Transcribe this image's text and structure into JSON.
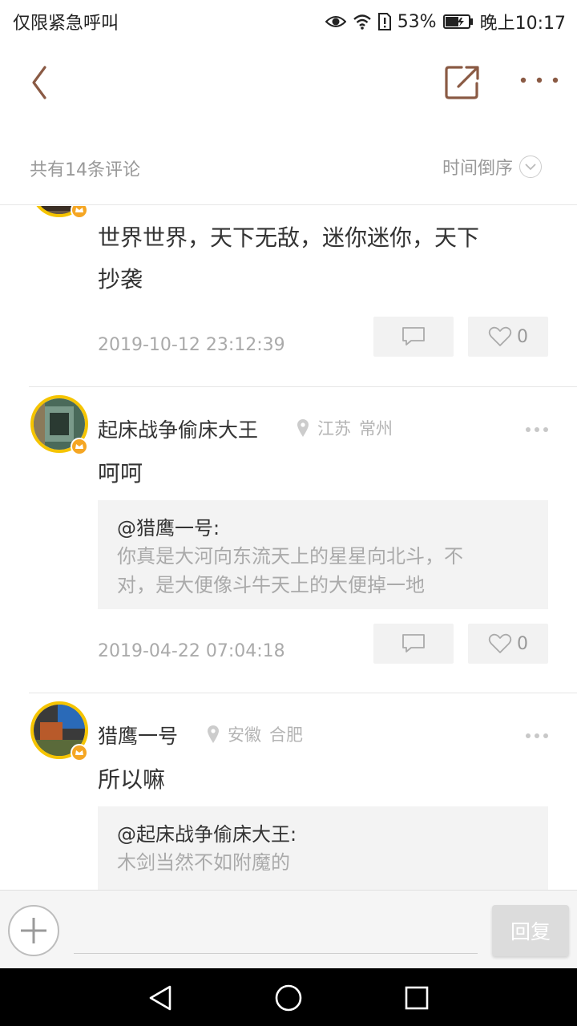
{
  "status_bar": {
    "carrier": "仅限紧急呼叫",
    "battery": "53%",
    "time": "晚上10:17"
  },
  "header": {
    "back_icon": "chevron-left-icon",
    "share_icon": "share-external-icon",
    "more_icon": "more-dots-icon"
  },
  "filter": {
    "count_label": "共有14条评论",
    "sort_label": "时间倒序"
  },
  "comments": [
    {
      "content_lines": [
        "世界世界，天下无敌，迷你迷你，天下",
        "抄袭"
      ],
      "time": "2019-10-12 23:12:39",
      "likes": "0"
    },
    {
      "name": "起床战争偷床大王",
      "province": "江苏",
      "city": "常州",
      "content": "呵呵",
      "quote_name": "@猎鹰一号:",
      "quote_lines": [
        "你真是大河向东流天上的星星向北斗，不",
        "对，是大便像斗牛天上的大便掉一地"
      ],
      "time": "2019-04-22 07:04:18",
      "likes": "0"
    },
    {
      "name": "猎鹰一号",
      "province": "安徽",
      "city": "合肥",
      "content": "所以嘛",
      "quote_name": "@起床战争偷床大王:",
      "quote_lines": [
        "木剑当然不如附魔的"
      ]
    }
  ],
  "input_bar": {
    "reply_label": "回复"
  },
  "colors": {
    "accent_brown": "#8a5a44",
    "avatar_ring": "#f5c400",
    "crown": "#f5a623"
  }
}
